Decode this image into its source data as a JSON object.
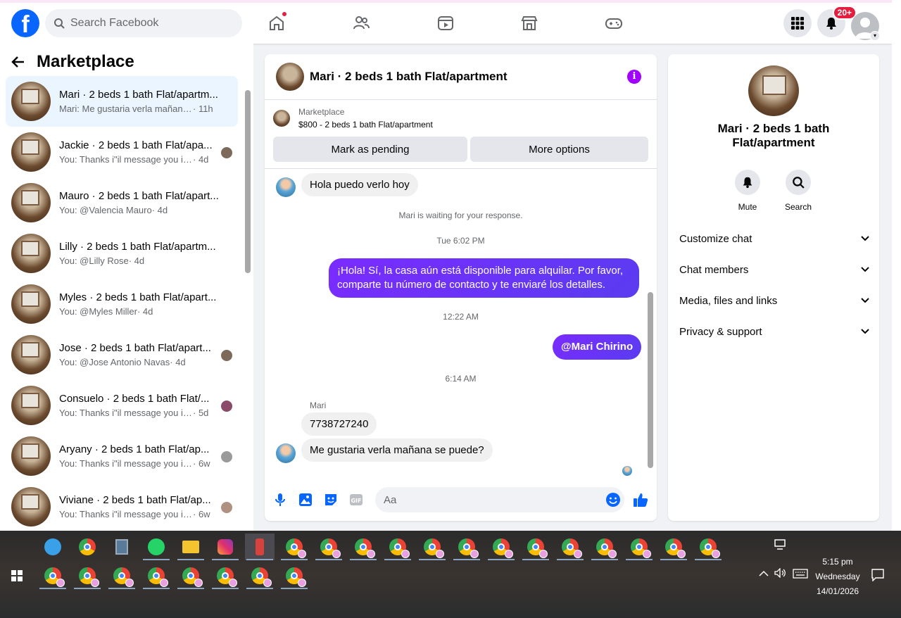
{
  "nav": {
    "logo": "f",
    "search_placeholder": "Search Facebook",
    "notif_badge": "20+"
  },
  "left": {
    "title": "Marketplace",
    "conversations": [
      {
        "title": "Mari · 2 beds 1 bath Flat/apartm...",
        "snippet": "Mari: Me gustaria verla mañana s...",
        "time": "· 11h",
        "active": true
      },
      {
        "title": "Jackie · 2 beds 1 bath Flat/apa...",
        "snippet": "You: Thanks i\"il message you in ...",
        "time": "· 4d"
      },
      {
        "title": "Mauro · 2 beds 1 bath Flat/apart...",
        "snippet": "You: @Valencia Mauro",
        "time": "· 4d"
      },
      {
        "title": "Lilly · 2 beds 1 bath Flat/apartm...",
        "snippet": "You: @Lilly Rose",
        "time": "· 4d"
      },
      {
        "title": "Myles · 2 beds 1 bath Flat/apart...",
        "snippet": "You: @Myles Miller",
        "time": "· 4d"
      },
      {
        "title": "Jose · 2 beds 1 bath Flat/apart...",
        "snippet": "You: @Jose Antonio Navas",
        "time": "· 4d"
      },
      {
        "title": "Consuelo · 2 beds 1 bath Flat/...",
        "snippet": "You: Thanks i\"il message you in ...",
        "time": "· 5d"
      },
      {
        "title": "Aryany · 2 beds 1 bath Flat/ap...",
        "snippet": "You: Thanks i\"il message you in ...",
        "time": "· 6w"
      },
      {
        "title": "Viviane · 2 beds 1 bath Flat/ap...",
        "snippet": "You: Thanks i\"il message you in ...",
        "time": "· 6w"
      }
    ]
  },
  "chat": {
    "title": "Mari · 2 beds 1 bath Flat/apartment",
    "listing_category": "Marketplace",
    "listing_price": "$800 - 2 beds 1 bath Flat/apartment",
    "btn_pending": "Mark as pending",
    "btn_more": "More options",
    "msg1": "Hola puedo verlo hoy",
    "waiting": "Mari is waiting for your response.",
    "time1": "Tue 6:02 PM",
    "msg2": "¡Hola! Sí, la casa aún está disponible para alquilar. Por favor, comparte tu número de contacto y te enviaré los detalles.",
    "time2": "12:22 AM",
    "msg3": "@Mari Chirino",
    "time3": "6:14 AM",
    "sender": "Mari",
    "msg4": "7738727240",
    "msg5": "Me gustaria verla mañana se puede?",
    "composer_placeholder": "Aa"
  },
  "right": {
    "title": "Mari · 2 beds 1 bath Flat/apartment",
    "mute": "Mute",
    "search": "Search",
    "sections": [
      "Customize chat",
      "Chat members",
      "Media, files and links",
      "Privacy & support"
    ]
  },
  "taskbar": {
    "time": "5:15 pm",
    "day": "Wednesday",
    "date": "14/01/2026"
  }
}
